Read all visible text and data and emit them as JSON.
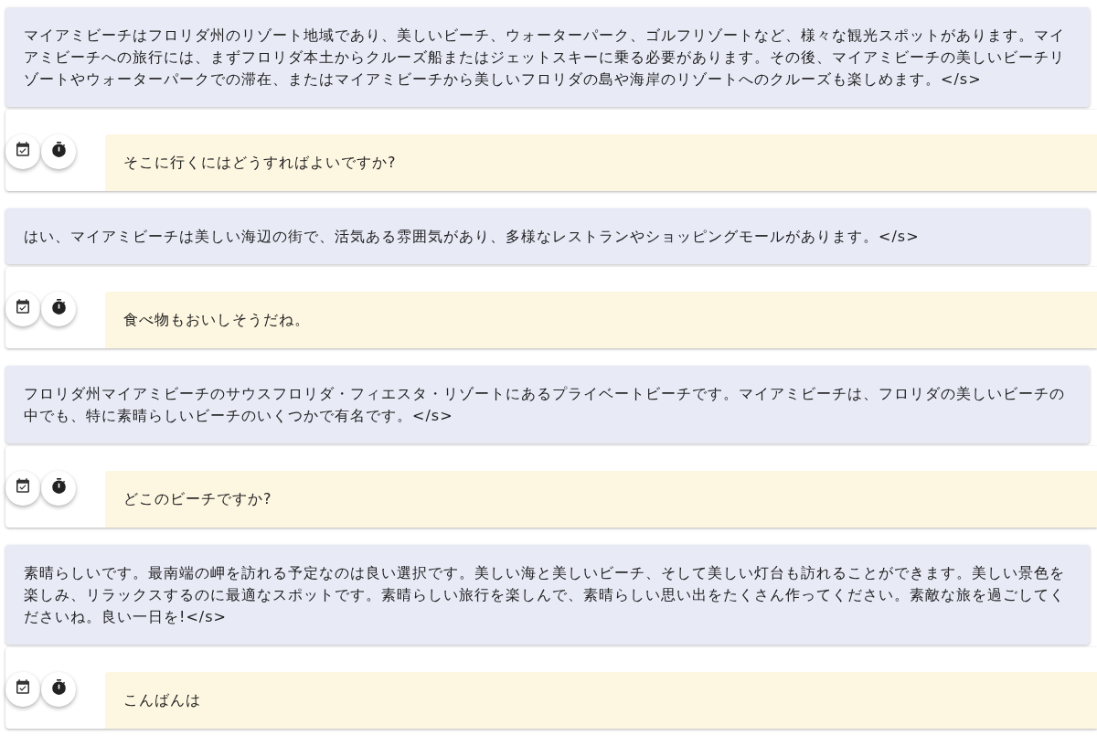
{
  "conversation": [
    {
      "kind": "assistant",
      "text": "マイアミビーチはフロリダ州のリゾート地域であり、美しいビーチ、ウォーターパーク、ゴルフリゾートなど、様々な観光スポットがあります。マイアミビーチへの旅行には、まずフロリダ本土からクルーズ船またはジェットスキーに乗る必要があります。その後、マイアミビーチの美しいビーチリゾートやウォーターパークでの滞在、またはマイアミビーチから美しいフロリダの島や海岸のリゾートへのクルーズも楽しめます。</s>"
    },
    {
      "kind": "user",
      "text": "そこに行くにはどうすればよいですか?"
    },
    {
      "kind": "assistant",
      "text": "はい、マイアミビーチは美しい海辺の街で、活気ある雰囲気があり、多様なレストランやショッピングモールがあります。</s>"
    },
    {
      "kind": "user",
      "text": "食べ物もおいしそうだね。"
    },
    {
      "kind": "assistant",
      "text": "フロリダ州マイアミビーチのサウスフロリダ・フィエスタ・リゾートにあるプライベートビーチです。マイアミビーチは、フロリダの美しいビーチの中でも、特に素晴らしいビーチのいくつかで有名です。</s>"
    },
    {
      "kind": "user",
      "text": "どこのビーチですか?"
    },
    {
      "kind": "assistant",
      "text": "素晴らしいです。最南端の岬を訪れる予定なのは良い選択です。美しい海と美しいビーチ、そして美しい灯台も訪れることができます。美しい景色を楽しみ、リラックスするのに最適なスポットです。素晴らしい旅行を楽しんで、素晴らしい思い出をたくさん作ってください。素敵な旅を過ごしてくださいね。良い一日を!</s>"
    },
    {
      "kind": "user",
      "text": "こんばんは"
    }
  ]
}
